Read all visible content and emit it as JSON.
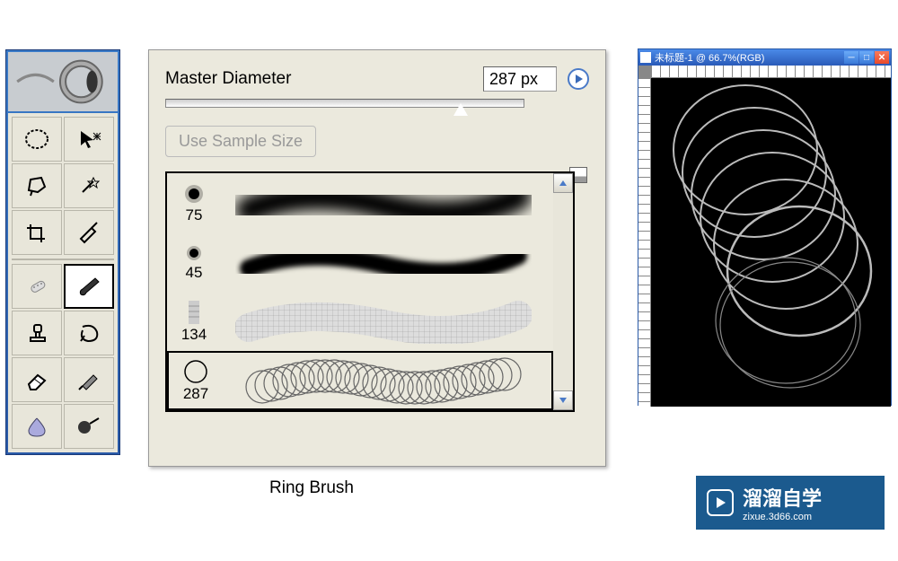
{
  "brushPanel": {
    "label": "Master Diameter",
    "diameterValue": "287 px",
    "sampleSizeLabel": "Use Sample Size",
    "brushes": [
      {
        "size": "75"
      },
      {
        "size": "45"
      },
      {
        "size": "134"
      },
      {
        "size": "287"
      }
    ]
  },
  "ringBrushLabel": "Ring Brush",
  "docWindow": {
    "title": "未标题-1 @ 66.7%(RGB)"
  },
  "watermark": {
    "cn": "溜溜自学",
    "url": "zixue.3d66.com"
  }
}
